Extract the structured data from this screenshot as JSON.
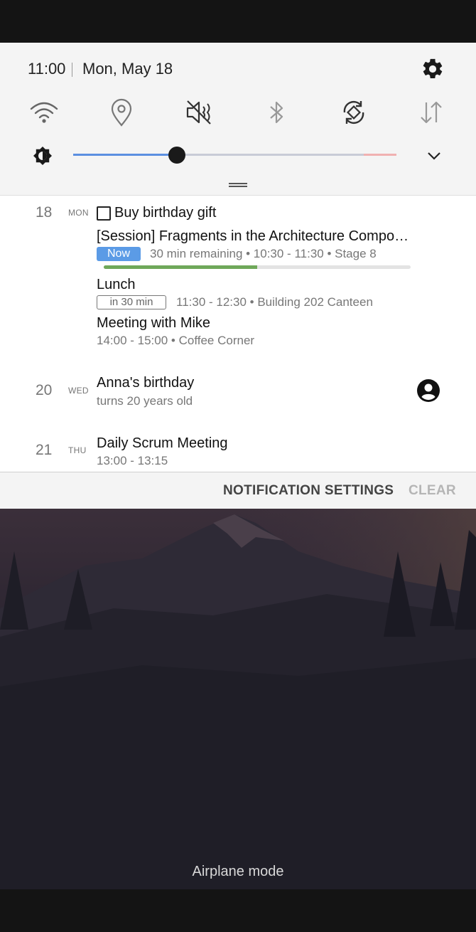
{
  "header": {
    "time": "11:00",
    "date": "Mon, May 18"
  },
  "quick_settings": {
    "icons": [
      "wifi-icon",
      "location-icon",
      "sound-off-icon",
      "bluetooth-icon",
      "auto-rotate-icon",
      "mobile-data-icon"
    ],
    "brightness_level": 0.32
  },
  "events": {
    "day18": {
      "num": "18",
      "name": "MON",
      "task": "Buy birthday gift",
      "session_title": "[Session] Fragments in the Architecture Compo…",
      "session_badge": "Now",
      "session_meta": "30 min remaining  •  10:30 - 11:30  •  Stage 8",
      "session_progress": 0.5,
      "lunch_title": "Lunch",
      "lunch_badge": "in 30 min",
      "lunch_meta": "11:30 - 12:30  •  Building 202 Canteen",
      "meeting_title": "Meeting with Mike",
      "meeting_meta": "14:00 - 15:00  •  Coffee Corner"
    },
    "day20": {
      "num": "20",
      "name": "WED",
      "title": "Anna's birthday",
      "sub": "turns 20 years old"
    },
    "day21": {
      "num": "21",
      "name": "THU",
      "title": "Daily Scrum Meeting",
      "sub": "13:00 - 13:15"
    }
  },
  "actions": {
    "settings": "NOTIFICATION SETTINGS",
    "clear": "CLEAR"
  },
  "status": {
    "mode": "Airplane mode"
  },
  "colors": {
    "accent": "#5b9be6",
    "progress": "#6fa85a"
  }
}
